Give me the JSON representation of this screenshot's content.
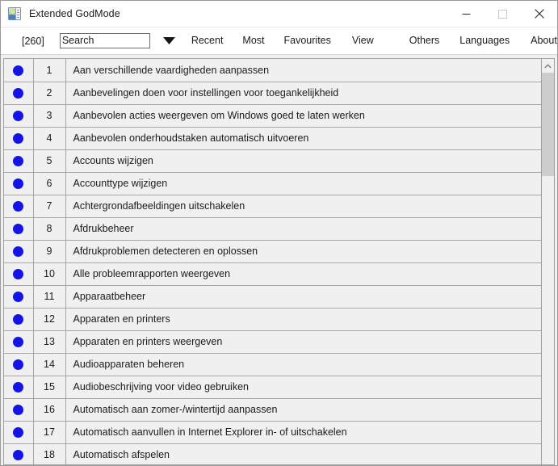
{
  "window": {
    "title": "Extended GodMode",
    "icon": "app-image-icon",
    "controls": {
      "minimize": "minimize-icon",
      "maximize": "maximize-icon",
      "close": "close-icon"
    }
  },
  "toolbar": {
    "count_badge": "[260]",
    "search": {
      "value": "Search",
      "placeholder": "Search"
    },
    "dropdown_arrow": "chevron-down-icon",
    "menu": [
      {
        "id": "recent",
        "label": "Recent"
      },
      {
        "id": "most",
        "label": "Most"
      },
      {
        "id": "favourites",
        "label": "Favourites"
      },
      {
        "id": "view",
        "label": "View"
      },
      {
        "id": "others",
        "label": "Others"
      },
      {
        "id": "languages",
        "label": "Languages"
      },
      {
        "id": "about",
        "label": "About"
      }
    ]
  },
  "list": {
    "bullet_color": "#1414e6",
    "rows": [
      {
        "num": "1",
        "label": "Aan verschillende vaardigheden aanpassen"
      },
      {
        "num": "2",
        "label": "Aanbevelingen doen voor instellingen voor toegankelijkheid"
      },
      {
        "num": "3",
        "label": "Aanbevolen acties weergeven om Windows goed te laten werken"
      },
      {
        "num": "4",
        "label": "Aanbevolen onderhoudstaken automatisch uitvoeren"
      },
      {
        "num": "5",
        "label": "Accounts wijzigen"
      },
      {
        "num": "6",
        "label": "Accounttype wijzigen"
      },
      {
        "num": "7",
        "label": "Achtergrondafbeeldingen uitschakelen"
      },
      {
        "num": "8",
        "label": "Afdrukbeheer"
      },
      {
        "num": "9",
        "label": "Afdrukproblemen detecteren en oplossen"
      },
      {
        "num": "10",
        "label": "Alle probleemrapporten weergeven"
      },
      {
        "num": "11",
        "label": "Apparaatbeheer"
      },
      {
        "num": "12",
        "label": "Apparaten en printers"
      },
      {
        "num": "13",
        "label": "Apparaten en printers weergeven"
      },
      {
        "num": "14",
        "label": "Audioapparaten beheren"
      },
      {
        "num": "15",
        "label": "Audiobeschrijving voor video gebruiken"
      },
      {
        "num": "16",
        "label": "Automatisch aan zomer-/wintertijd aanpassen"
      },
      {
        "num": "17",
        "label": "Automatisch aanvullen in Internet Explorer in- of uitschakelen"
      },
      {
        "num": "18",
        "label": "Automatisch afspelen"
      }
    ]
  },
  "scrollbar": {
    "up_arrow": "chevron-up-icon",
    "down_arrow": "chevron-down-icon"
  }
}
